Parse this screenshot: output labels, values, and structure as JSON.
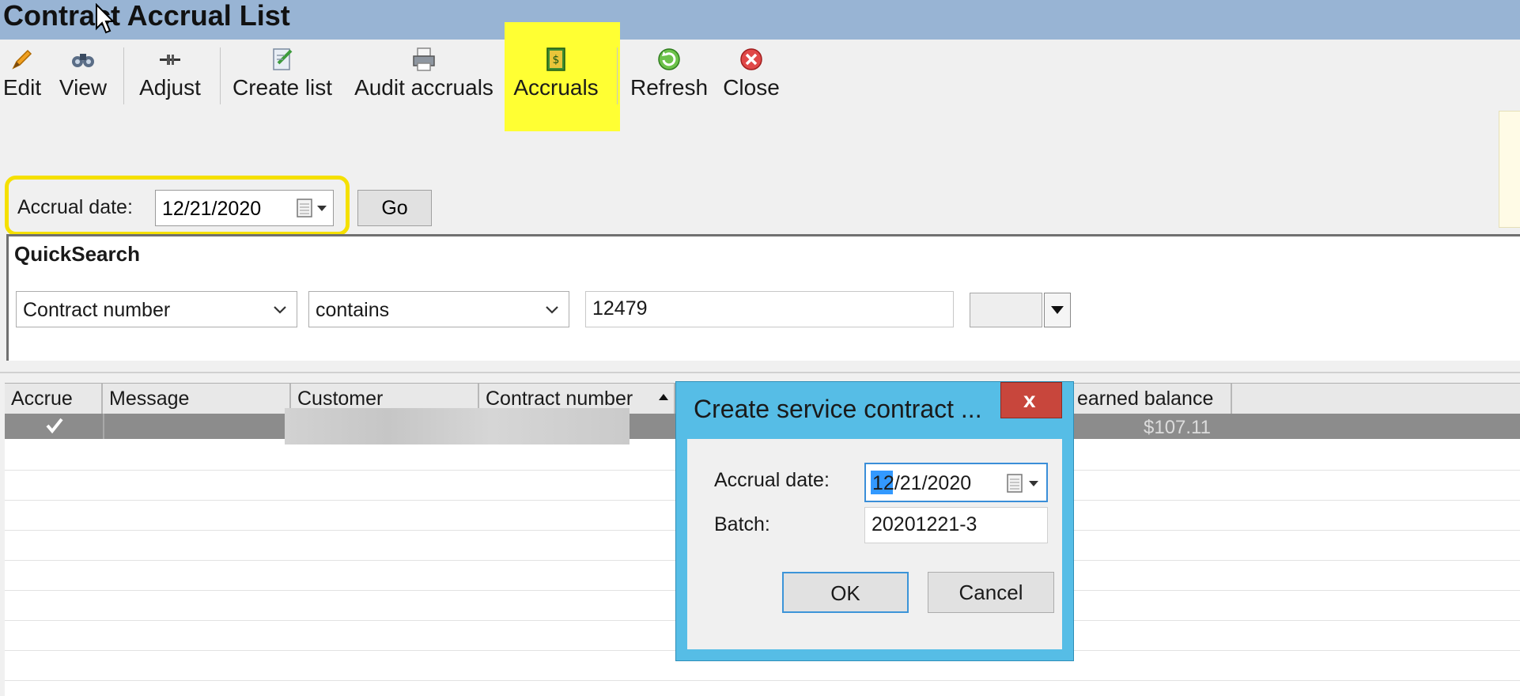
{
  "window": {
    "title": "Contract Accrual List"
  },
  "toolbar": {
    "buttons": [
      {
        "id": "edit",
        "label": "Edit",
        "icon": "pencil-icon"
      },
      {
        "id": "view",
        "label": "View",
        "icon": "binoculars-icon"
      },
      {
        "id": "adjust",
        "label": "Adjust",
        "icon": "adjust-icon"
      },
      {
        "id": "create_list",
        "label": "Create list",
        "icon": "create-list-icon"
      },
      {
        "id": "audit_accruals",
        "label": "Audit accruals",
        "icon": "printer-icon"
      },
      {
        "id": "accruals",
        "label": "Accruals",
        "icon": "ledger-icon"
      },
      {
        "id": "refresh",
        "label": "Refresh",
        "icon": "refresh-icon"
      },
      {
        "id": "close",
        "label": "Close",
        "icon": "close-icon"
      }
    ]
  },
  "accrual_filter": {
    "label": "Accrual date:",
    "value": "12/21/2020",
    "go_label": "Go"
  },
  "quick_search": {
    "title": "QuickSearch",
    "field": "Contract number",
    "operator": "contains",
    "value": "12479"
  },
  "grid": {
    "columns": [
      "Accrue",
      "Message",
      "Customer",
      "Contract number",
      "earned balance"
    ],
    "rows": [
      {
        "accrue": true,
        "message": "",
        "amount": "$107.11"
      }
    ]
  },
  "dialog": {
    "title": "Create service contract ...",
    "close_label": "x",
    "accrual_date_label": "Accrual date:",
    "accrual_date_selected": "12",
    "accrual_date_rest": "/21/2020",
    "batch_label": "Batch:",
    "batch_value": "20201221-3",
    "ok_label": "OK",
    "cancel_label": "Cancel"
  },
  "colors": {
    "titlebar": "#98b4d4",
    "highlight": "#ffff33",
    "dialog_frame": "#56bde6",
    "dialog_close": "#c8463c"
  }
}
